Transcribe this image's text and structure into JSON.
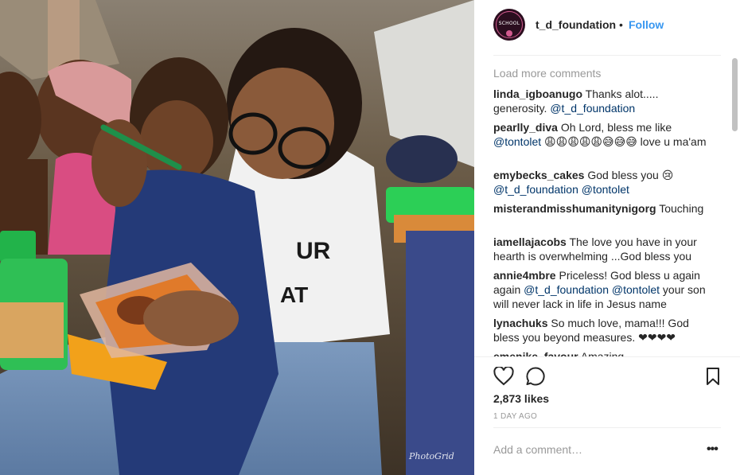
{
  "photo": {
    "alt_icon": "post-photo",
    "watermark": "PhotoGrid",
    "shirt_text_top": "UR",
    "shirt_text_bottom": "AT"
  },
  "header": {
    "avatar_logo_text": "SCHOOL",
    "username": "t_d_foundation",
    "separator": "•",
    "follow_label": "Follow"
  },
  "comments": {
    "load_more": "Load more comments",
    "items": [
      {
        "author": "linda_igboanugo",
        "text": "Thanks alot..... generosity. ",
        "mention": "@t_d_foundation",
        "tail": ""
      },
      {
        "author": "pearlly_diva",
        "text": "Oh Lord, bless me like ",
        "mention": "@tontolet",
        "tail": " 😩😩😩😩😩😅😅😅 love u ma'am"
      },
      {
        "author": "emybecks_cakes",
        "text": "God bless you 😢 ",
        "mention": "@t_d_foundation @tontolet",
        "tail": ""
      },
      {
        "author": "misterandmisshumanitynigorg",
        "text": "Touching",
        "mention": "",
        "tail": ""
      },
      {
        "author": "iamellajacobs",
        "text": "The love you have in your hearth is overwhelming ...God bless you",
        "mention": "",
        "tail": ""
      },
      {
        "author": "annie4mbre",
        "text": "Priceless! God bless u again again ",
        "mention": "@t_d_foundation @tontolet",
        "tail": " your son will never lack in life in Jesus name"
      },
      {
        "author": "lynachuks",
        "text": "So much love, mama!!! God bless you beyond measures. ❤❤❤❤",
        "mention": "",
        "tail": ""
      },
      {
        "author": "emenike_favour",
        "text": "Amazing",
        "mention": "",
        "tail": ""
      }
    ]
  },
  "actions": {
    "likes": "2,873 likes",
    "age": "1 DAY AGO",
    "comment_placeholder": "Add a comment…",
    "more_label": "•••"
  },
  "colors": {
    "link_blue": "#3897f0",
    "mention": "#003569",
    "muted": "#999999",
    "text": "#262626"
  }
}
